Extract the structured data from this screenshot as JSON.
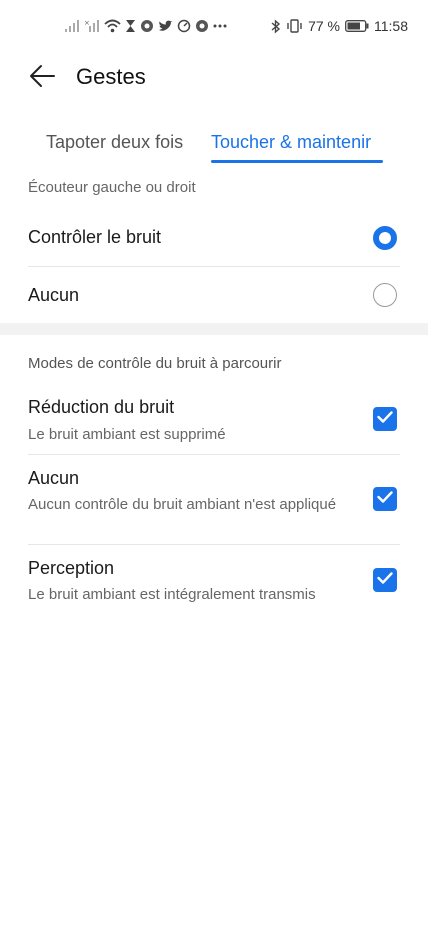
{
  "status_bar": {
    "battery": "77 %",
    "time": "11:58",
    "left_icons": [
      "signal-icon",
      "signal-icon",
      "wifi-icon",
      "hourglass-icon",
      "chrome-icon",
      "twitter-icon",
      "speedometer-icon",
      "chrome-icon",
      "more-icon"
    ],
    "right_icons": [
      "bluetooth-icon",
      "vibrate-icon",
      "battery-icon"
    ]
  },
  "header": {
    "title": "Gestes",
    "back_icon": "arrow-left-icon"
  },
  "tabs": {
    "items": [
      {
        "label": "Tapoter deux fois",
        "active": false
      },
      {
        "label": "Toucher & maintenir",
        "active": true
      }
    ]
  },
  "section1": {
    "caption": "Écouteur gauche ou droit",
    "options": [
      {
        "label": "Contrôler le bruit",
        "selected": true
      },
      {
        "label": "Aucun",
        "selected": false
      }
    ]
  },
  "section2": {
    "caption": "Modes de contrôle du bruit à parcourir",
    "modes": [
      {
        "title": "Réduction du bruit",
        "subtitle": "Le bruit ambiant est supprimé",
        "checked": true
      },
      {
        "title": "Aucun",
        "subtitle": "Aucun contrôle du bruit ambiant n'est appliqué",
        "checked": true
      },
      {
        "title": "Perception",
        "subtitle": "Le bruit ambiant est intégralement transmis",
        "checked": true
      }
    ]
  },
  "colors": {
    "accent": "#1a73e8",
    "band": "#f2f2f2",
    "divider": "#e6e6e6"
  }
}
